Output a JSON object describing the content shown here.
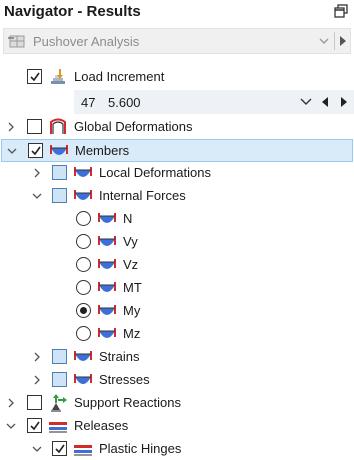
{
  "panel": {
    "title": "Navigator - Results",
    "pin_icon": "restore-window-icon"
  },
  "analysis": {
    "selected": "Pushover Analysis",
    "icon": "pushover-analysis-icon"
  },
  "load_increment": {
    "label": "Load Increment",
    "number": "47",
    "value": "5.600"
  },
  "tree": {
    "global_deformations": "Global Deformations",
    "members": "Members",
    "local_deformations": "Local Deformations",
    "internal_forces": "Internal Forces",
    "forces": [
      {
        "label": "N",
        "selected": false
      },
      {
        "label": "Vy",
        "selected": false
      },
      {
        "label": "Vz",
        "selected": false
      },
      {
        "label": "MT",
        "selected": false
      },
      {
        "label": "My",
        "selected": true
      },
      {
        "label": "Mz",
        "selected": false
      }
    ],
    "strains": "Strains",
    "stresses": "Stresses",
    "support_reactions": "Support Reactions",
    "releases": "Releases",
    "plastic_hinges": "Plastic Hinges"
  },
  "colors": {
    "selection_bg": "#d9ebf9",
    "selection_border": "#99c9ef",
    "diagram_red": "#d22b2b",
    "diagram_blue": "#3e6fd8"
  }
}
